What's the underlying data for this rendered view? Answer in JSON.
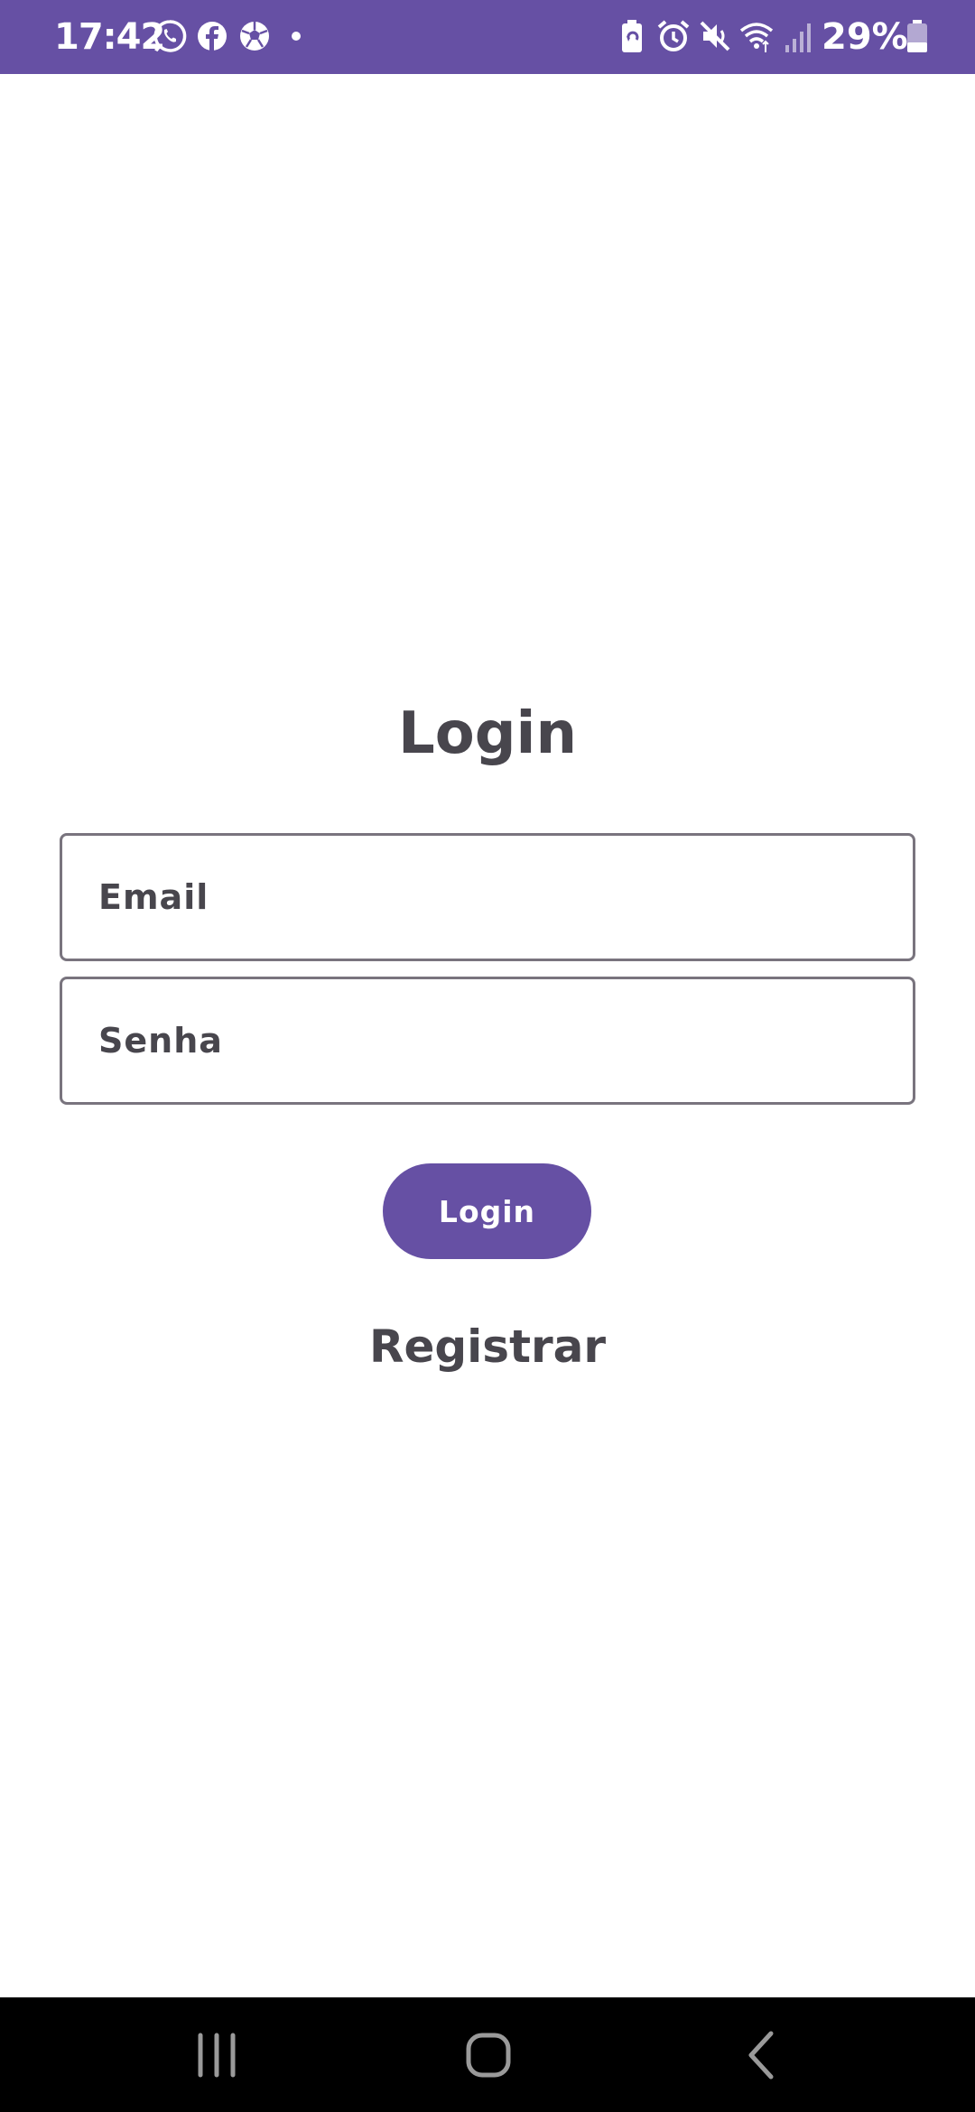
{
  "status_bar": {
    "time": "17:42",
    "notification_icons": [
      "whatsapp-icon",
      "facebook-icon",
      "soccer-ball-icon",
      "dot-icon"
    ],
    "system_icons": [
      "battery-saver-icon",
      "alarm-icon",
      "mute-icon",
      "wifi-icon",
      "signal-icon",
      "battery-icon"
    ],
    "battery_text": "29%",
    "battery_level_percent": 29,
    "background_color": "#6650a4"
  },
  "login": {
    "title": "Login",
    "email_placeholder": "Email",
    "email_value": "",
    "password_placeholder": "Senha",
    "password_value": "",
    "login_button_label": "Login",
    "register_link_label": "Registrar",
    "accent_color": "#6650a4",
    "text_color": "#48464d"
  },
  "nav_bar": {
    "buttons": [
      "recent-apps-icon",
      "home-icon",
      "back-icon"
    ]
  }
}
